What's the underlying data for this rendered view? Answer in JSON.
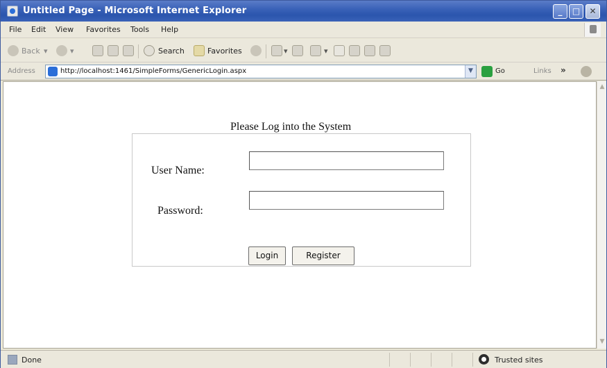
{
  "window": {
    "title": "Untitled Page - Microsoft Internet Explorer",
    "min_glyph": "_",
    "max_glyph": "□",
    "close_glyph": "✕"
  },
  "menubar": {
    "items": [
      "File",
      "Edit",
      "View",
      "Favorites",
      "Tools",
      "Help"
    ]
  },
  "toolbar": {
    "back_label": "Back",
    "search_label": "Search",
    "favorites_label": "Favorites"
  },
  "addressbar": {
    "label": "Address",
    "url": "http://localhost:1461/SimpleForms/GenericLogin.aspx",
    "go_label": "Go",
    "links_label": "Links",
    "links_chevron": "»"
  },
  "content": {
    "heading": "Please Log into the System",
    "username_label": "User Name:",
    "password_label": "Password:",
    "username_value": "",
    "password_value": "",
    "login_button": "Login",
    "register_button": "Register"
  },
  "statusbar": {
    "text": "Done",
    "zone": "Trusted sites"
  },
  "colors": {
    "titlebar": "#2b55ad",
    "chrome": "#ebe8dc",
    "go_green": "#2aa040"
  }
}
